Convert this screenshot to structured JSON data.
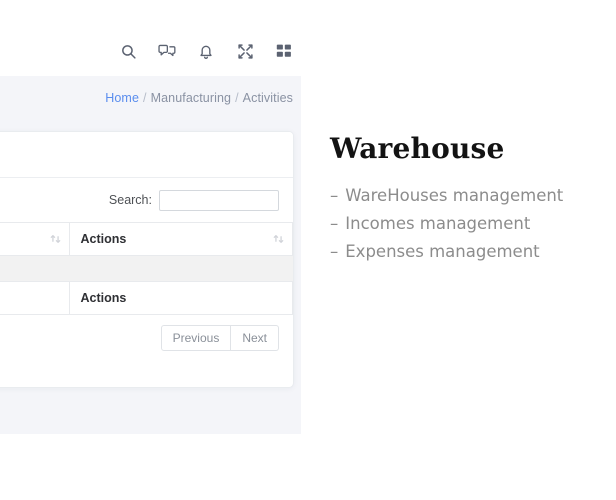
{
  "app": {
    "navbar": {
      "icons": [
        {
          "name": "search-icon",
          "label": "Search"
        },
        {
          "name": "chat-icon",
          "label": "Messages"
        },
        {
          "name": "bell-icon",
          "label": "Notifications"
        },
        {
          "name": "fullscreen-icon",
          "label": "Fullscreen"
        },
        {
          "name": "apps-grid-icon",
          "label": "Apps"
        }
      ]
    },
    "breadcrumb": {
      "home": "Home",
      "sep1": "/",
      "section": "Manufacturing",
      "sep2": "/",
      "current": "Activities"
    },
    "card": {
      "search": {
        "label": "Search:",
        "value": "",
        "placeholder": ""
      },
      "table": {
        "headers": [
          "",
          "Actions"
        ],
        "footers": [
          "",
          "Actions"
        ],
        "rows": [
          {
            "cells": [
              "",
              ""
            ]
          }
        ]
      },
      "pagination": {
        "previous": "Previous",
        "next": "Next"
      }
    }
  },
  "overlay": {
    "title": "Warehouse",
    "items": [
      {
        "dash": "–",
        "text": "WareHouses management"
      },
      {
        "dash": "–",
        "text": "Incomes management"
      },
      {
        "dash": "–",
        "text": "Expenses management"
      }
    ]
  },
  "colors": {
    "link": "#5a8dee",
    "page_bg": "#f4f5f9",
    "card_bg": "#ffffff",
    "row_stripe": "#f2f2f2",
    "muted_text": "#8c8c8c",
    "title_text": "#131313"
  }
}
